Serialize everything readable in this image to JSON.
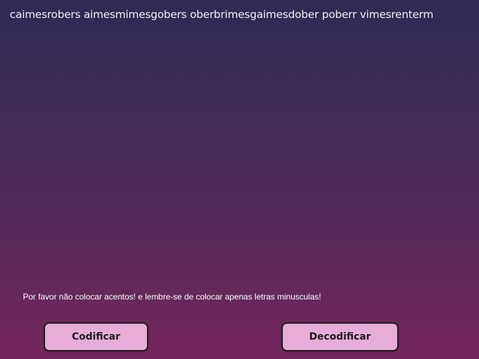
{
  "output": {
    "text": "caimesrobers aimesmimesgobers oberbrimesgaimesdober poberr vimesrenterm"
  },
  "notice": {
    "text": "Por favor não colocar acentos! e lembre-se de colocar apenas letras minusculas!"
  },
  "actions": {
    "encode_label": "Codificar",
    "decode_label": "Decodificar"
  },
  "colors": {
    "background_top": "#2f2a55",
    "background_bottom": "#74265c",
    "button_bg": "#e8acd8",
    "button_border": "#1c1c22",
    "text_light": "#eef0f6"
  }
}
